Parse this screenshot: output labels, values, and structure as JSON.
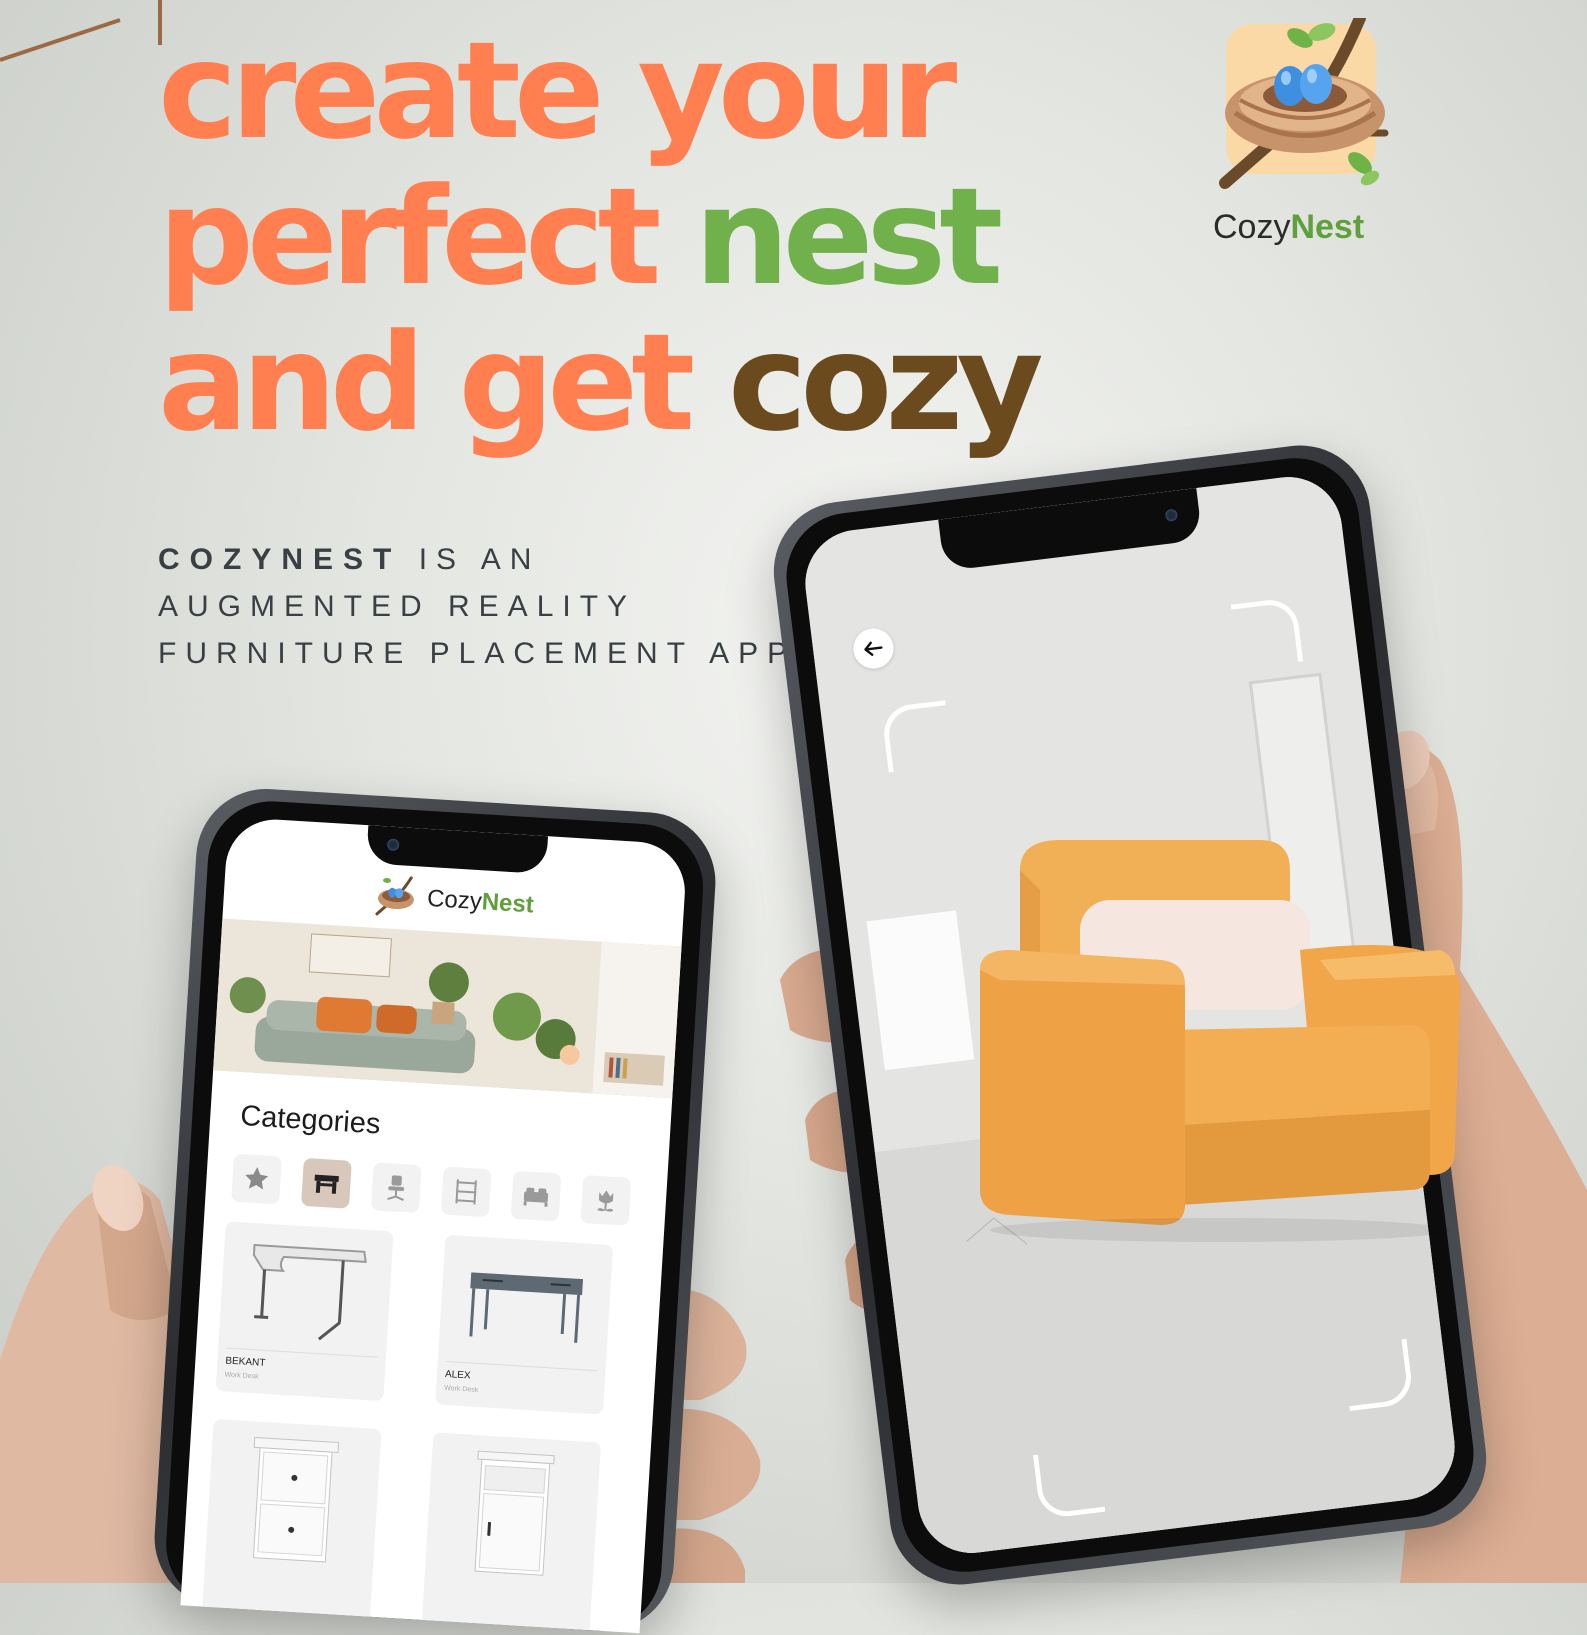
{
  "headline": {
    "line1": "create your",
    "line2_a": "perfect ",
    "line2_b": "nest",
    "line3_a": "and get ",
    "line3_b": "cozy"
  },
  "tagline": {
    "brand": "COZYNEST",
    "rest1": " IS AN",
    "line2": "AUGMENTED REALITY",
    "line3": "FURNITURE PLACEMENT APP"
  },
  "logo": {
    "word_a": "Cozy",
    "word_b": "Nest"
  },
  "colors": {
    "orange": "#ff7f50",
    "green": "#70b14b",
    "brown": "#6b4a1e",
    "logo_tile": "#fbd9a6"
  },
  "catalog_screen": {
    "app_name_a": "Cozy",
    "app_name_b": "Nest",
    "categories_title": "Categories",
    "categories": [
      {
        "icon": "star-icon",
        "active": false
      },
      {
        "icon": "desk-icon",
        "active": true
      },
      {
        "icon": "office-chair-icon",
        "active": false
      },
      {
        "icon": "shelf-icon",
        "active": false
      },
      {
        "icon": "bed-icon",
        "active": false
      },
      {
        "icon": "plant-icon",
        "active": false
      }
    ],
    "products": [
      {
        "name": "BEKANT",
        "type": "Work Desk"
      },
      {
        "name": "ALEX",
        "type": "Work Desk"
      },
      {
        "name": "",
        "type": ""
      },
      {
        "name": "",
        "type": ""
      }
    ]
  },
  "ar_screen": {
    "back_icon": "arrow-left-icon"
  }
}
